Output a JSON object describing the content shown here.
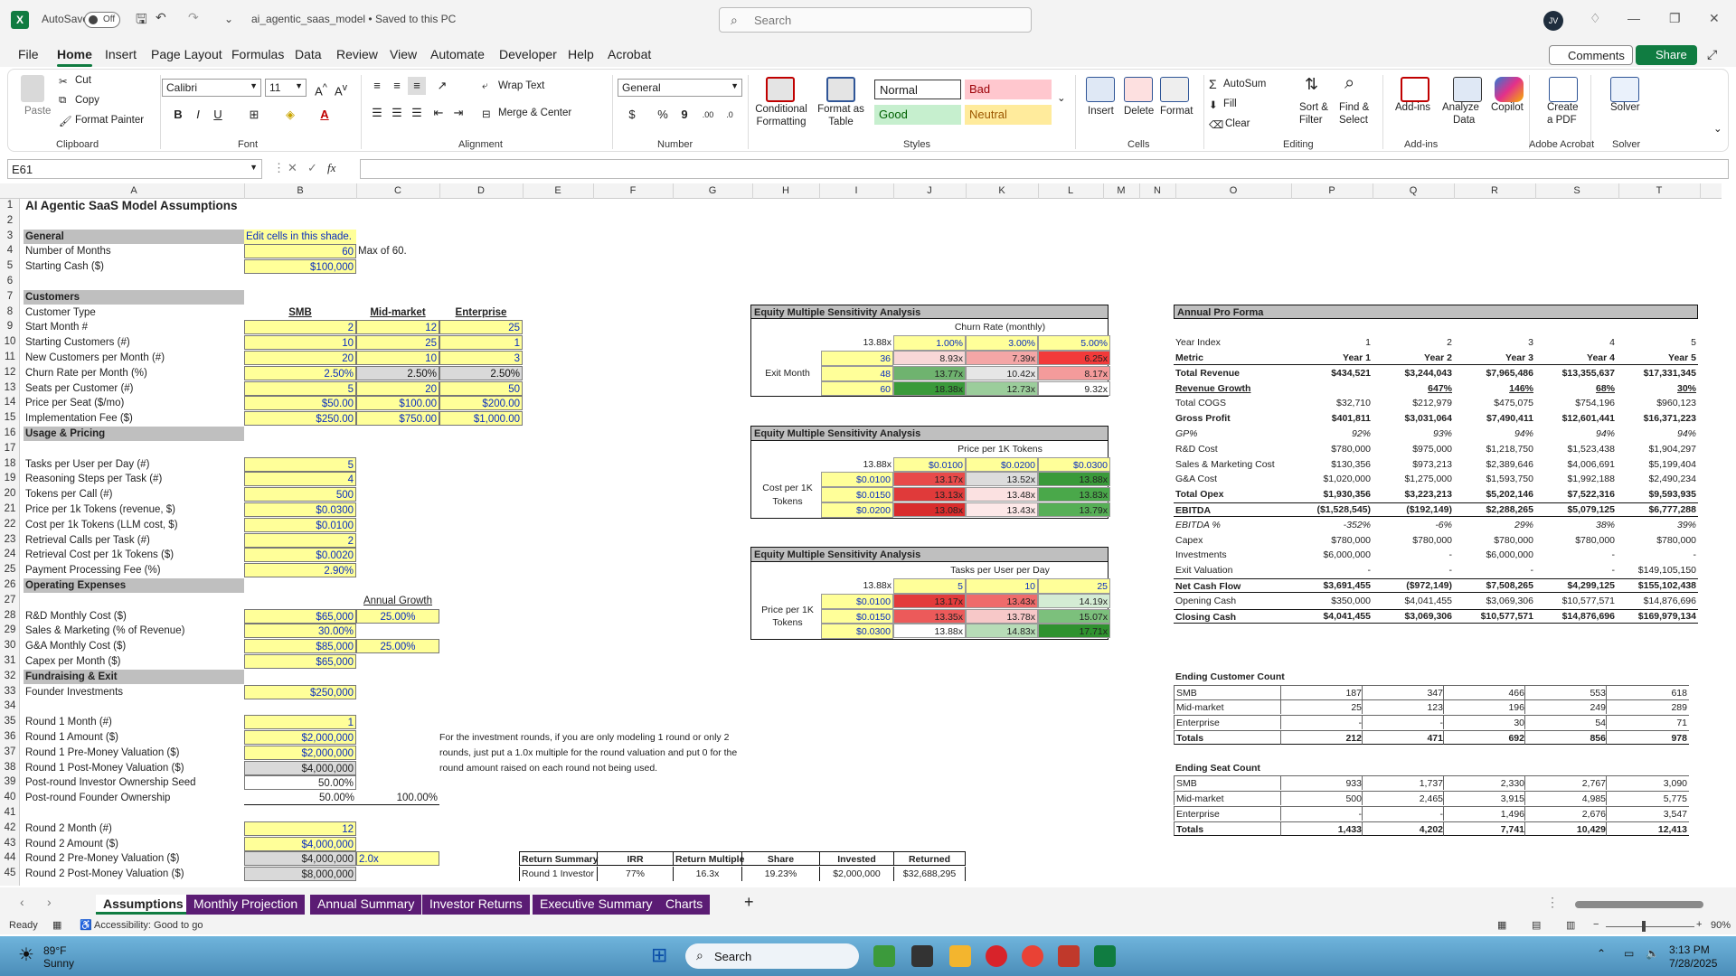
{
  "titlebar": {
    "autosave": "AutoSave",
    "toggle": "Off",
    "doc": "ai_agentic_saas_model • Saved to this PC",
    "search": "Search",
    "avatar": "JV"
  },
  "menu": {
    "tabs": [
      "File",
      "Home",
      "Insert",
      "Page Layout",
      "Formulas",
      "Data",
      "Review",
      "View",
      "Automate",
      "Developer",
      "Help",
      "Acrobat"
    ],
    "comments": "Comments",
    "share": "Share"
  },
  "ribbon": {
    "clipboard": {
      "paste": "Paste",
      "cut": "Cut",
      "copy": "Copy",
      "format_painter": "Format Painter",
      "label": "Clipboard"
    },
    "font": {
      "family": "Calibri",
      "size": "11",
      "label": "Font"
    },
    "alignment": {
      "wrap": "Wrap Text",
      "merge": "Merge & Center",
      "label": "Alignment"
    },
    "number": {
      "format": "General",
      "label": "Number"
    },
    "styles": {
      "cond": "Conditional",
      "cond2": "Formatting",
      "fmt_table": "Format as",
      "fmt_table2": "Table",
      "normal": "Normal",
      "bad": "Bad",
      "good": "Good",
      "neutral": "Neutral",
      "label": "Styles"
    },
    "cells": {
      "insert": "Insert",
      "delete": "Delete",
      "format": "Format",
      "label": "Cells"
    },
    "editing": {
      "autosum": "AutoSum",
      "fill": "Fill",
      "clear": "Clear",
      "sort": "Sort &",
      "sort2": "Filter",
      "find": "Find &",
      "find2": "Select",
      "label": "Editing"
    },
    "addins": {
      "addins": "Add-ins",
      "analyze": "Analyze",
      "analyze2": "Data",
      "copilot": "Copilot",
      "label": "Add-ins"
    },
    "acrobat": {
      "create": "Create",
      "create2": "a PDF",
      "label": "Adobe Acrobat"
    },
    "solver": {
      "solver": "Solver",
      "label": "Solver"
    }
  },
  "formula": {
    "namebox": "E61",
    "fx": "fx",
    "value": ""
  },
  "columns": [
    "A",
    "B",
    "C",
    "D",
    "E",
    "F",
    "G",
    "H",
    "I",
    "J",
    "K",
    "L",
    "M",
    "N",
    "O",
    "P",
    "Q",
    "R",
    "S",
    "T"
  ],
  "rows": [
    "1",
    "2",
    "3",
    "4",
    "5",
    "6",
    "7",
    "8",
    "9",
    "10",
    "11",
    "12",
    "13",
    "14",
    "15",
    "16",
    "17",
    "18",
    "19",
    "20",
    "21",
    "22",
    "23",
    "24",
    "25",
    "26",
    "27",
    "28",
    "29",
    "30",
    "31",
    "32",
    "33",
    "34",
    "35",
    "36",
    "37",
    "38",
    "39",
    "40",
    "41",
    "42",
    "43",
    "44",
    "45"
  ],
  "assumptions": {
    "title": "AI Agentic SaaS Model Assumptions",
    "general": "General",
    "edit_note": "Edit cells in this shade.",
    "num_months": "Number of Months",
    "num_months_val": "60",
    "max_note": "Max of 60.",
    "start_cash": "Starting Cash ($)",
    "start_cash_val": "$100,000",
    "customers": "Customers",
    "cust_type": "Customer Type",
    "smb": "SMB",
    "mid": "Mid-market",
    "ent": "Enterprise",
    "rows": [
      {
        "label": "Start Month #",
        "v": [
          "2",
          "12",
          "25"
        ]
      },
      {
        "label": "Starting Customers (#)",
        "v": [
          "10",
          "25",
          "1"
        ]
      },
      {
        "label": "New Customers per Month (#)",
        "v": [
          "20",
          "10",
          "3"
        ]
      },
      {
        "label": "Churn Rate per Month (%)",
        "v": [
          "2.50%",
          "2.50%",
          "2.50%"
        ]
      },
      {
        "label": "Seats per Customer (#)",
        "v": [
          "5",
          "20",
          "50"
        ]
      },
      {
        "label": "Price per Seat ($/mo)",
        "v": [
          "$50.00",
          "$100.00",
          "$200.00"
        ]
      },
      {
        "label": "Implementation Fee ($)",
        "v": [
          "$250.00",
          "$750.00",
          "$1,000.00"
        ]
      }
    ],
    "usage": "Usage & Pricing",
    "usage_rows": [
      {
        "label": "Tasks per User per Day (#)",
        "v": "5"
      },
      {
        "label": "Reasoning Steps per Task (#)",
        "v": "4"
      },
      {
        "label": "Tokens per Call (#)",
        "v": "500"
      },
      {
        "label": "Price per 1k Tokens (revenue, $)",
        "v": "$0.0300"
      },
      {
        "label": "Cost per 1k Tokens (LLM cost, $)",
        "v": "$0.0100"
      },
      {
        "label": "Retrieval Calls per Task (#)",
        "v": "2"
      },
      {
        "label": "Retrieval Cost per 1k Tokens ($)",
        "v": "$0.0020"
      },
      {
        "label": "Payment Processing Fee (%)",
        "v": "2.90%"
      }
    ],
    "opex": "Operating Expenses",
    "annual_growth": "Annual Growth",
    "rd": "R&D Monthly Cost ($)",
    "rd_v": "$65,000",
    "rd_g": "25.00%",
    "sm": "Sales & Marketing (% of Revenue)",
    "sm_v": "30.00%",
    "ga": "G&A Monthly Cost ($)",
    "ga_v": "$85,000",
    "ga_g": "25.00%",
    "capex": "Capex per Month ($)",
    "capex_v": "$65,000",
    "fund": "Fundraising & Exit",
    "founder": "Founder Investments",
    "founder_v": "$250,000",
    "r1m": "Round 1 Month (#)",
    "r1m_v": "1",
    "r1a": "Round 1 Amount ($)",
    "r1a_v": "$2,000,000",
    "r1pre": "Round 1 Pre-Money Valuation ($)",
    "r1pre_v": "$2,000,000",
    "r1post": "Round 1 Post-Money Valuation ($)",
    "r1post_v": "$4,000,000",
    "pis": "Post-round Investor Ownership Seed",
    "pis_v": "50.00%",
    "pfo": "Post-round Founder Ownership",
    "pfo_v": "50.00%",
    "pfo_c": "100.00%",
    "r2m": "Round 2 Month (#)",
    "r2m_v": "12",
    "r2a": "Round 2 Amount ($)",
    "r2a_v": "$4,000,000",
    "r2pre": "Round 2 Pre-Money Valuation ($)",
    "r2pre_v": "$4,000,000",
    "r2pre_c": "2.0x",
    "r2post": "Round 2 Post-Money Valuation ($)",
    "r2post_v": "$8,000,000",
    "note1": "For the investment rounds, if you are only modeling 1 round or only 2",
    "note2": "rounds, just put a 1.0x multiple for the round valuation and put 0 for the",
    "note3": "round amount raised on each round not being used."
  },
  "sens1": {
    "title": "Equity Multiple Sensitivity Analysis",
    "col_title": "Churn Rate (monthly)",
    "corner": "13.88x",
    "cols": [
      "1.00%",
      "3.00%",
      "5.00%"
    ],
    "row_label": "Exit Month",
    "rows": [
      "36",
      "48",
      "60"
    ],
    "vals": [
      [
        "8.93x",
        "7.39x",
        "6.25x"
      ],
      [
        "13.77x",
        "10.42x",
        "8.17x"
      ],
      [
        "18.38x",
        "12.73x",
        "9.32x"
      ]
    ],
    "colors": [
      [
        "#f8d7d7",
        "#f4a6a6",
        "#f23a3a"
      ],
      [
        "#6fb36f",
        "#e6e6e6",
        "#f49b9b"
      ],
      [
        "#3a9a3a",
        "#9bcd9b",
        "#ffffff"
      ]
    ]
  },
  "sens2": {
    "title": "Equity Multiple Sensitivity Analysis",
    "col_title": "Price per 1K Tokens",
    "corner": "13.88x",
    "cols": [
      "$0.0100",
      "$0.0200",
      "$0.0300"
    ],
    "row_label1": "Cost per 1K",
    "row_label2": "Tokens",
    "rows": [
      "$0.0100",
      "$0.0150",
      "$0.0200"
    ],
    "vals": [
      [
        "13.17x",
        "13.52x",
        "13.88x"
      ],
      [
        "13.13x",
        "13.48x",
        "13.83x"
      ],
      [
        "13.08x",
        "13.43x",
        "13.79x"
      ]
    ],
    "colors": [
      [
        "#e84a4a",
        "#dcdcdc",
        "#3a9a3a"
      ],
      [
        "#e03a3a",
        "#fbe1e1",
        "#4aa84a"
      ],
      [
        "#d92c2c",
        "#fde8e8",
        "#56af56"
      ]
    ]
  },
  "sens3": {
    "title": "Equity Multiple Sensitivity Analysis",
    "col_title": "Tasks per User per Day",
    "corner": "13.88x",
    "cols": [
      "5",
      "10",
      "25"
    ],
    "row_label1": "Price per 1K",
    "row_label2": "Tokens",
    "rows": [
      "$0.0100",
      "$0.0150",
      "$0.0300"
    ],
    "vals": [
      [
        "13.17x",
        "13.43x",
        "14.19x"
      ],
      [
        "13.35x",
        "13.78x",
        "15.07x"
      ],
      [
        "13.88x",
        "14.83x",
        "17.71x"
      ]
    ],
    "colors": [
      [
        "#e33b3b",
        "#ef6b6b",
        "#d4ecd4"
      ],
      [
        "#ec5a5a",
        "#f7c8c8",
        "#7cc07c"
      ],
      [
        "#ffffff",
        "#b7dcb7",
        "#2f922f"
      ]
    ]
  },
  "proforma": {
    "title": "Annual Pro Forma",
    "year_index_label": "Year Index",
    "year_index": [
      "1",
      "2",
      "3",
      "4",
      "5"
    ],
    "metric_label": "Metric",
    "years": [
      "Year 1",
      "Year 2",
      "Year 3",
      "Year 4",
      "Year 5"
    ],
    "rows": [
      {
        "label": "Total Revenue",
        "v": [
          "$434,521",
          "$3,244,043",
          "$7,965,486",
          "$13,355,637",
          "$17,331,345"
        ],
        "s": "b"
      },
      {
        "label": "Revenue Growth",
        "v": [
          "",
          "647%",
          "146%",
          "68%",
          "30%"
        ],
        "s": "bu"
      },
      {
        "label": "Total COGS",
        "v": [
          "$32,710",
          "$212,979",
          "$475,075",
          "$754,196",
          "$960,123"
        ],
        "s": ""
      },
      {
        "label": "Gross Profit",
        "v": [
          "$401,811",
          "$3,031,064",
          "$7,490,411",
          "$12,601,441",
          "$16,371,223"
        ],
        "s": "b"
      },
      {
        "label": "GP%",
        "v": [
          "92%",
          "93%",
          "94%",
          "94%",
          "94%"
        ],
        "s": "i"
      },
      {
        "label": "R&D Cost",
        "v": [
          "$780,000",
          "$975,000",
          "$1,218,750",
          "$1,523,438",
          "$1,904,297"
        ],
        "s": ""
      },
      {
        "label": "Sales & Marketing Cost",
        "v": [
          "$130,356",
          "$973,213",
          "$2,389,646",
          "$4,006,691",
          "$5,199,404"
        ],
        "s": ""
      },
      {
        "label": "G&A Cost",
        "v": [
          "$1,020,000",
          "$1,275,000",
          "$1,593,750",
          "$1,992,188",
          "$2,490,234"
        ],
        "s": ""
      },
      {
        "label": "Total Opex",
        "v": [
          "$1,930,356",
          "$3,223,213",
          "$5,202,146",
          "$7,522,316",
          "$9,593,935"
        ],
        "s": "b"
      },
      {
        "label": "EBITDA",
        "v": [
          "($1,528,545)",
          "($192,149)",
          "$2,288,265",
          "$5,079,125",
          "$6,777,288"
        ],
        "s": "bline"
      },
      {
        "label": "EBITDA %",
        "v": [
          "-352%",
          "-6%",
          "29%",
          "38%",
          "39%"
        ],
        "s": "i"
      },
      {
        "label": "Capex",
        "v": [
          "$780,000",
          "$780,000",
          "$780,000",
          "$780,000",
          "$780,000"
        ],
        "s": ""
      },
      {
        "label": "Investments",
        "v": [
          "$6,000,000",
          "-",
          "$6,000,000",
          "-",
          "-"
        ],
        "s": ""
      },
      {
        "label": "Exit Valuation",
        "v": [
          "-",
          "-",
          "-",
          "-",
          "$149,105,150"
        ],
        "s": ""
      },
      {
        "label": "Net Cash Flow",
        "v": [
          "$3,691,455",
          "($972,149)",
          "$7,508,265",
          "$4,299,125",
          "$155,102,438"
        ],
        "s": "bline"
      },
      {
        "label": "Opening Cash",
        "v": [
          "$350,000",
          "$4,041,455",
          "$3,069,306",
          "$10,577,571",
          "$14,876,696"
        ],
        "s": ""
      },
      {
        "label": "Closing Cash",
        "v": [
          "$4,041,455",
          "$3,069,306",
          "$10,577,571",
          "$14,876,696",
          "$169,979,134"
        ],
        "s": "bline"
      }
    ]
  },
  "customers_end": {
    "title": "Ending Customer Count",
    "rows": [
      {
        "label": "SMB",
        "v": [
          "187",
          "347",
          "466",
          "553",
          "618"
        ]
      },
      {
        "label": "Mid-market",
        "v": [
          "25",
          "123",
          "196",
          "249",
          "289"
        ]
      },
      {
        "label": "Enterprise",
        "v": [
          "-",
          "-",
          "30",
          "54",
          "71"
        ]
      },
      {
        "label": "Totals",
        "v": [
          "212",
          "471",
          "692",
          "856",
          "978"
        ]
      }
    ]
  },
  "seats_end": {
    "title": "Ending Seat Count",
    "rows": [
      {
        "label": "SMB",
        "v": [
          "933",
          "1,737",
          "2,330",
          "2,767",
          "3,090"
        ]
      },
      {
        "label": "Mid-market",
        "v": [
          "500",
          "2,465",
          "3,915",
          "4,985",
          "5,775"
        ]
      },
      {
        "label": "Enterprise",
        "v": [
          "-",
          "-",
          "1,496",
          "2,676",
          "3,547"
        ]
      },
      {
        "label": "Totals",
        "v": [
          "1,433",
          "4,202",
          "7,741",
          "10,429",
          "12,413"
        ]
      }
    ]
  },
  "returns": {
    "headers": [
      "Return Summary",
      "IRR",
      "Return Multiple",
      "Share",
      "Invested",
      "Returned"
    ],
    "row": [
      "Round 1 Investor",
      "77%",
      "16.3x",
      "19.23%",
      "$2,000,000",
      "$32,688,295"
    ]
  },
  "sheets": [
    "Assumptions",
    "Monthly Projection",
    "Annual Summary",
    "Investor Returns",
    "Executive Summary",
    "Charts"
  ],
  "status": {
    "ready": "Ready",
    "access": "Accessibility: Good to go",
    "zoom": "90%"
  },
  "taskbar": {
    "temp": "89°F",
    "weather": "Sunny",
    "search": "Search",
    "time": "3:13 PM",
    "date": "7/28/2025"
  }
}
